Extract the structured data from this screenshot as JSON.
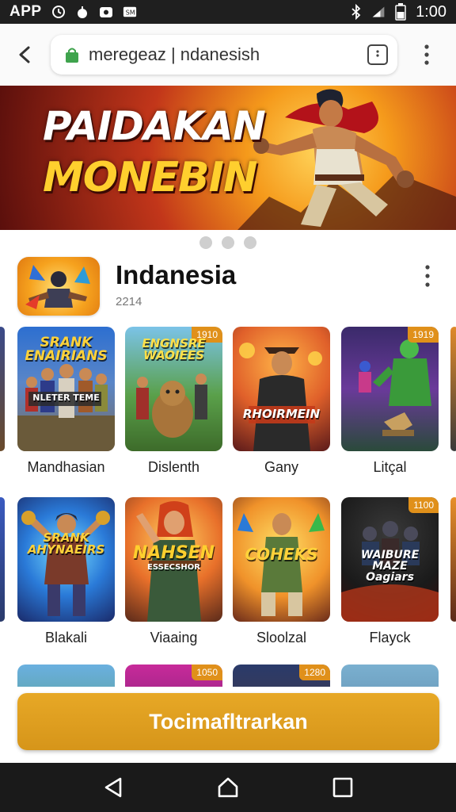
{
  "status_bar": {
    "app_label": "APP",
    "time": "1:00",
    "icons": [
      "sync-icon",
      "apple-icon",
      "camera-icon",
      "sim-icon",
      "bluetooth-icon",
      "signal-icon",
      "battery-icon"
    ]
  },
  "browser": {
    "url": "meregeaz | ndanesish",
    "icons": [
      "back-arrow-icon",
      "lock-icon",
      "tab-switcher-icon",
      "more-vertical-icon"
    ]
  },
  "banner": {
    "line1": "PAIDAKAN",
    "line2": "MONEBIN"
  },
  "carousel": {
    "dots": 3
  },
  "app": {
    "name": "Indanesia",
    "subtitle": "2214"
  },
  "games": [
    {
      "label": "Mandhasian",
      "title": "SRANK\nENAIRIANS",
      "sub": "NLETER TEME",
      "badge": ""
    },
    {
      "label": "Dislenth",
      "title": "ENGNSRE\nWAOIEES",
      "sub": "",
      "badge": "1910"
    },
    {
      "label": "Gany",
      "title": "RHOIRMEIN",
      "sub": "",
      "badge": ""
    },
    {
      "label": "Litçal",
      "title": "",
      "sub": "",
      "badge": "1919"
    },
    {
      "label": "Blakali",
      "title": "SRANK\nAHYNAEIRS",
      "sub": "",
      "badge": ""
    },
    {
      "label": "Viaaing",
      "title": "NAHSEN",
      "sub": "ESSECSHOR",
      "badge": ""
    },
    {
      "label": "Sloolzal",
      "title": "COHEKS",
      "sub": "",
      "badge": ""
    },
    {
      "label": "Flayck",
      "title": "WAIBURE\nMAZE\nOagiars",
      "sub": "",
      "badge": "1100"
    },
    {
      "label": "",
      "title": "",
      "sub": "",
      "badge": ""
    },
    {
      "label": "",
      "title": "",
      "sub": "",
      "badge": "1050"
    },
    {
      "label": "",
      "title": "",
      "sub": "",
      "badge": "1280"
    },
    {
      "label": "",
      "title": "",
      "sub": "",
      "badge": ""
    }
  ],
  "cta": {
    "label": "Tocimafltrarkan"
  },
  "colors": {
    "accent": "#d99a1e",
    "status_bar": "#1f1f1f",
    "nav_bar": "#1a1a1a"
  }
}
